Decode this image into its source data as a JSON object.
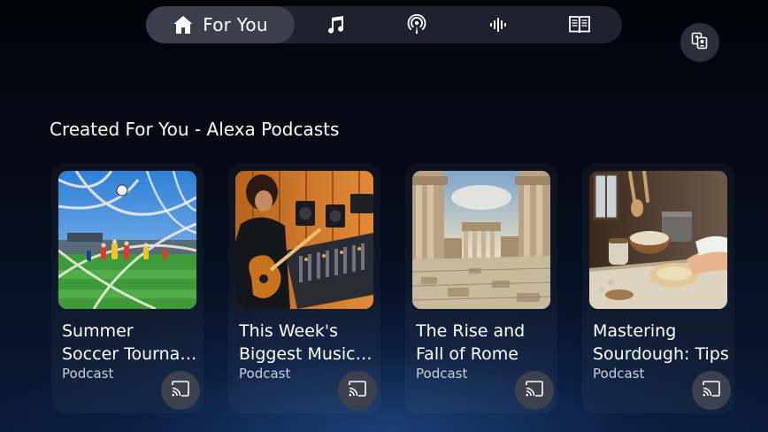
{
  "nav": {
    "tabs": [
      {
        "label": "For You",
        "icon": "home-icon",
        "active": true
      },
      {
        "label": "",
        "icon": "music-note-icon",
        "active": false
      },
      {
        "label": "",
        "icon": "podcast-icon",
        "active": false
      },
      {
        "label": "",
        "icon": "audio-waveform-icon",
        "active": false
      },
      {
        "label": "",
        "icon": "book-icon",
        "active": false
      }
    ]
  },
  "profile": {
    "icon": "switch-profile-icon"
  },
  "section": {
    "title": "Created For You - Alexa Podcasts"
  },
  "cards": [
    {
      "title_line1": "Summer",
      "title_line2": "Soccer Tournament",
      "subtitle": "Podcast",
      "image": "soccer-goal-image",
      "cast_icon": "cast-icon"
    },
    {
      "title_line1": "This Week's",
      "title_line2": "Biggest Music News",
      "subtitle": "Podcast",
      "image": "musician-studio-image",
      "cast_icon": "cast-icon"
    },
    {
      "title_line1": "The Rise and",
      "title_line2": "Fall of Rome",
      "subtitle": "Podcast",
      "image": "roman-ruins-image",
      "cast_icon": "cast-icon"
    },
    {
      "title_line1": "Mastering",
      "title_line2": "Sourdough: Tips",
      "subtitle": "Podcast",
      "image": "baking-bread-image",
      "cast_icon": "cast-icon"
    }
  ],
  "colors": {
    "background": "#050b18",
    "nav_bar": "#1c2230",
    "nav_active": "#3a404c",
    "button": "#3b414d",
    "text": "#ffffff"
  }
}
